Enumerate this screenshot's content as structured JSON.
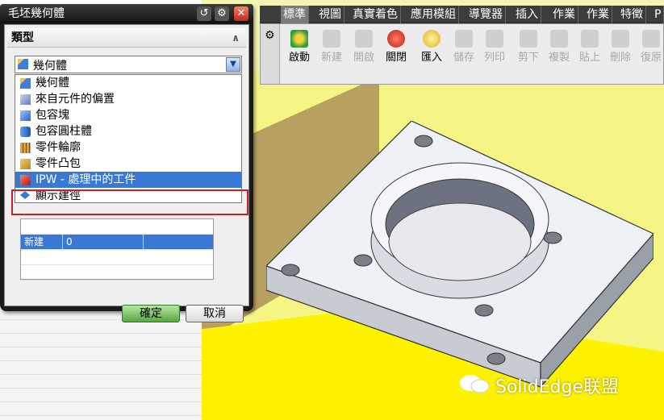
{
  "dialog": {
    "title": "毛坯幾何體",
    "group_label": "類型",
    "selected_type": "幾何體",
    "dropdown_items": [
      {
        "label": "幾何體",
        "icon": "geometry-icon"
      },
      {
        "label": "來自元件的偏置",
        "icon": "offset-icon"
      },
      {
        "label": "包容塊",
        "icon": "bounding-block-icon"
      },
      {
        "label": "包容圓柱體",
        "icon": "bounding-cylinder-icon"
      },
      {
        "label": "零件輪廓",
        "icon": "part-outline-icon"
      },
      {
        "label": "零件凸包",
        "icon": "convex-hull-icon"
      },
      {
        "label": "IPW - 處理中的工件",
        "icon": "ipw-icon",
        "selected": true
      },
      {
        "label": "顯示建徑",
        "icon": "show-path-icon"
      }
    ],
    "table_row": [
      "新建",
      "0"
    ],
    "ok_label": "確定",
    "cancel_label": "取消"
  },
  "menubar": [
    "標準",
    "視圖",
    "真實着色",
    "應用模組",
    "導覽器",
    "插入",
    "作業",
    "作業",
    "特徵",
    "P"
  ],
  "toolbar": [
    {
      "label": "啟動",
      "disabled": false,
      "icon": "start-icon"
    },
    {
      "label": "新建",
      "disabled": true,
      "icon": "new-icon"
    },
    {
      "label": "開啟",
      "disabled": true,
      "icon": "open-icon"
    },
    {
      "label": "關閉",
      "disabled": false,
      "icon": "close-icon"
    },
    {
      "label": "匯入",
      "disabled": false,
      "icon": "import-icon"
    },
    {
      "label": "儲存",
      "disabled": true,
      "icon": "save-icon"
    },
    {
      "label": "列印",
      "disabled": true,
      "icon": "print-icon"
    },
    {
      "label": "剪下",
      "disabled": true,
      "icon": "cut-icon"
    },
    {
      "label": "複製",
      "disabled": true,
      "icon": "copy-icon"
    },
    {
      "label": "貼上",
      "disabled": true,
      "icon": "paste-icon"
    },
    {
      "label": "刪除",
      "disabled": true,
      "icon": "delete-icon"
    },
    {
      "label": "復原",
      "disabled": true,
      "icon": "undo-icon"
    }
  ],
  "watermark": "SolidEdge联盟",
  "colors": {
    "selection": "#3a78d6",
    "highlight_box": "#c8202a",
    "ok_button": "#57a740"
  }
}
